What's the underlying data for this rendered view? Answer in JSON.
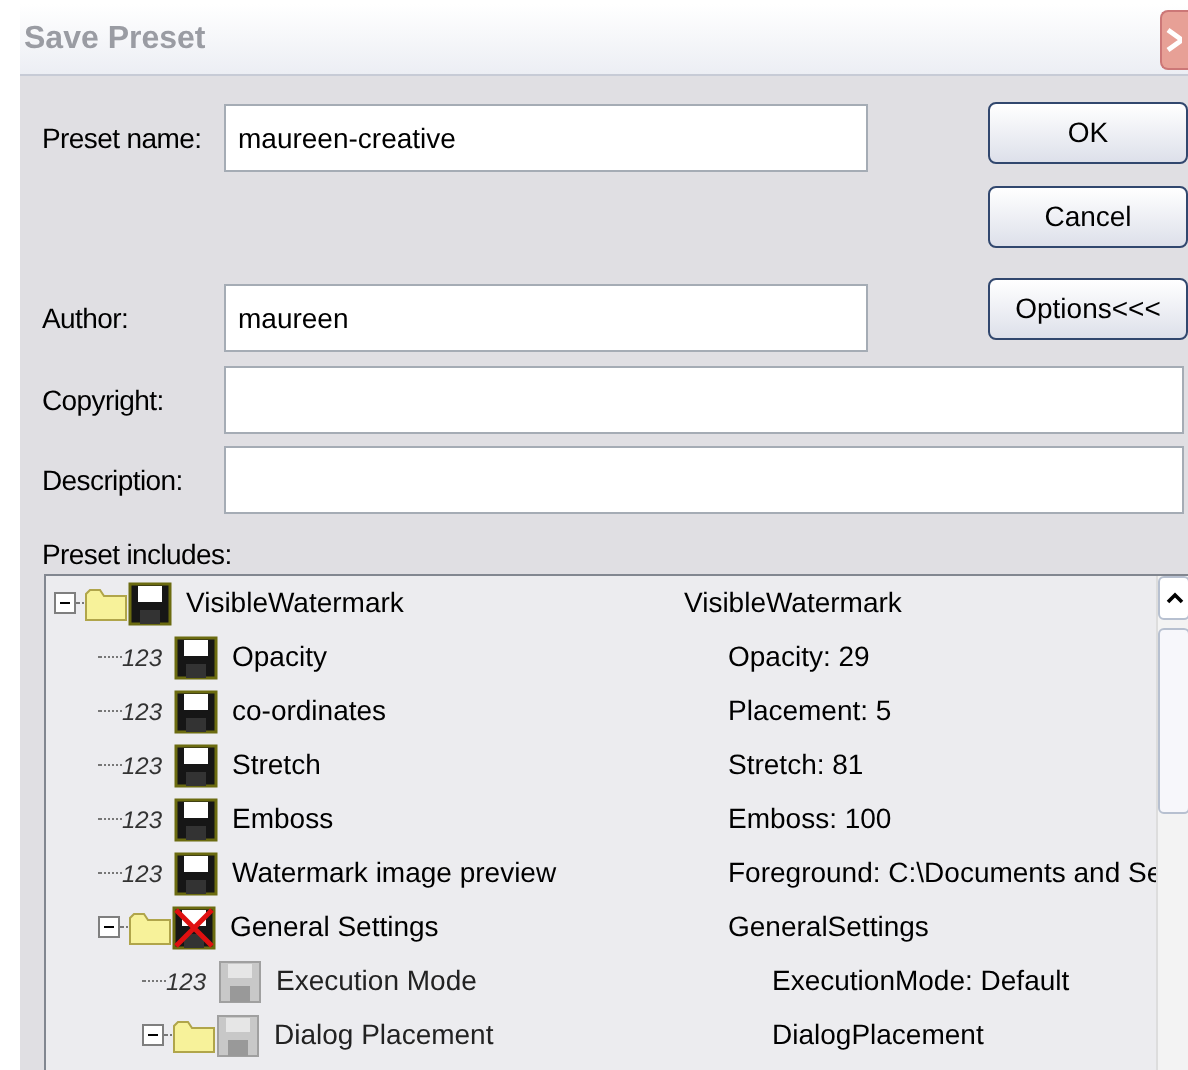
{
  "window": {
    "title": "Save Preset"
  },
  "fields": [
    {
      "label": "Preset name:",
      "value": "maureen-creative"
    },
    {
      "label": "Author:",
      "value": "maureen"
    },
    {
      "label": "Copyright:"
    },
    {
      "label": "Description:"
    }
  ],
  "buttons": [
    "OK",
    "Cancel",
    "Options<<<"
  ],
  "tree_label": "Preset includes:",
  "tree": [
    {
      "kind": "group",
      "name": "VisibleWatermark",
      "value": "VisibleWatermark",
      "included": true,
      "disabled": false,
      "expanded": true,
      "children": [
        {
          "kind": "value",
          "type_label": "123",
          "name": "Opacity",
          "value": "Opacity: 29",
          "included": true,
          "disabled": false
        },
        {
          "kind": "value",
          "type_label": "123",
          "name": "co-ordinates",
          "value": "Placement: 5",
          "included": true,
          "disabled": false
        },
        {
          "kind": "value",
          "type_label": "123",
          "name": "Stretch",
          "value": "Stretch: 81",
          "included": true,
          "disabled": false
        },
        {
          "kind": "value",
          "type_label": "123",
          "name": "Emboss",
          "value": "Emboss: 100",
          "included": true,
          "disabled": false
        },
        {
          "kind": "value",
          "type_label": "123",
          "name": "Watermark image preview",
          "value": "Foreground: C:\\Documents and Se",
          "included": true,
          "disabled": false
        },
        {
          "kind": "group",
          "name": "General Settings",
          "value": "GeneralSettings",
          "included": false,
          "disabled": false,
          "expanded": true,
          "children": [
            {
              "kind": "value",
              "type_label": "123",
              "name": "Execution Mode",
              "value": "ExecutionMode: Default",
              "included": true,
              "disabled": true
            },
            {
              "kind": "group",
              "name": "Dialog Placement",
              "value": "DialogPlacement",
              "included": true,
              "disabled": true,
              "expanded": true
            }
          ]
        }
      ]
    }
  ]
}
